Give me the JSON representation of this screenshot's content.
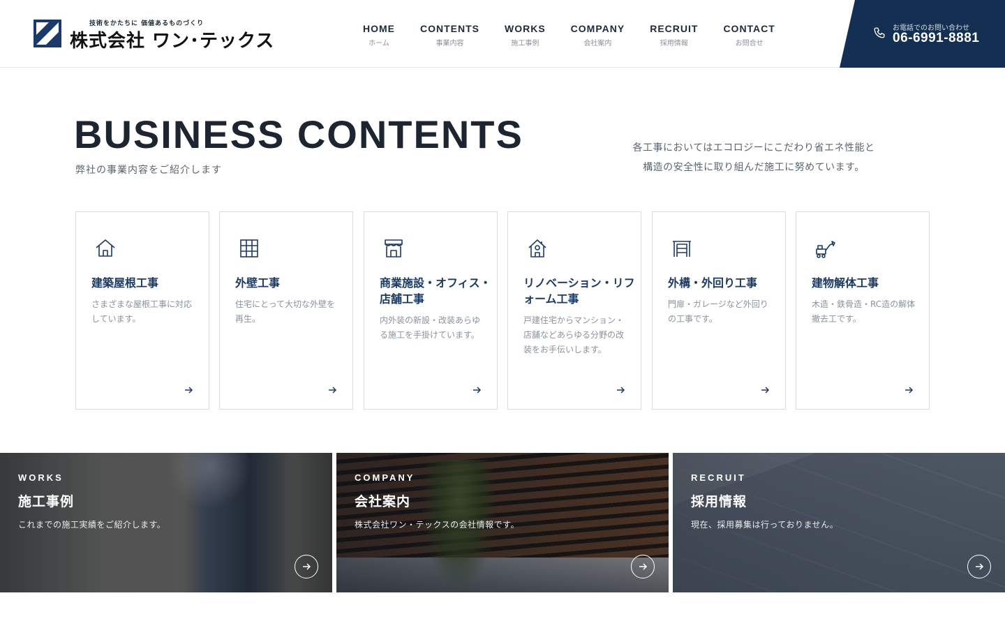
{
  "header": {
    "logo_tagline": "技術をかたちに 価値あるものづくり",
    "logo_name": "株式会社 ワン･テックス",
    "nav": [
      {
        "en": "HOME",
        "ja": "ホーム"
      },
      {
        "en": "CONTENTS",
        "ja": "事業内容"
      },
      {
        "en": "WORKS",
        "ja": "施工事例"
      },
      {
        "en": "COMPANY",
        "ja": "会社案内"
      },
      {
        "en": "RECRUIT",
        "ja": "採用情報"
      },
      {
        "en": "CONTACT",
        "ja": "お問合せ"
      }
    ],
    "phone_label": "お電話でのお問い合わせ",
    "phone_number": "06-6991-8881"
  },
  "hero": {
    "title": "BUSINESS CONTENTS",
    "subtitle": "弊社の事業内容をご紹介します",
    "description_line1": "各工事においてはエコロジーにこだわり省エネ性能と",
    "description_line2": "構造の安全性に取り組んだ施工に努めています。"
  },
  "cards": [
    {
      "icon": "house-icon",
      "title": "建築屋根工事",
      "desc": "さまざまな屋根工事に対応しています。"
    },
    {
      "icon": "wall-grid-icon",
      "title": "外壁工事",
      "desc": "住宅にとって大切な外壁を再生。"
    },
    {
      "icon": "storefront-icon",
      "title": "商業施設・オフィス・店舗工事",
      "desc": "内外装の新設・改装あらゆる施工を手掛けています。"
    },
    {
      "icon": "house-renovation-icon",
      "title": "リノベーション・リフォーム工事",
      "desc": "戸建住宅からマンション・店舗などあらゆる分野の改装をお手伝いします。"
    },
    {
      "icon": "gate-icon",
      "title": "外構・外回り工事",
      "desc": "門扉・ガレージなど外回りの工事です。"
    },
    {
      "icon": "excavator-icon",
      "title": "建物解体工事",
      "desc": "木造・鉄骨造・RC造の解体撤去工です。"
    }
  ],
  "panels": [
    {
      "en": "WORKS",
      "ja": "施工事例",
      "desc": "これまでの施工実績をご紹介します。"
    },
    {
      "en": "COMPANY",
      "ja": "会社案内",
      "desc": "株式会社ワン・テックスの会社情報です。"
    },
    {
      "en": "RECRUIT",
      "ja": "採用情報",
      "desc": "現在、採用募集は行っておりません。"
    }
  ],
  "colors": {
    "brand_navy": "#132f52",
    "card_title": "#1b3a63",
    "text_muted": "#8a929c"
  }
}
